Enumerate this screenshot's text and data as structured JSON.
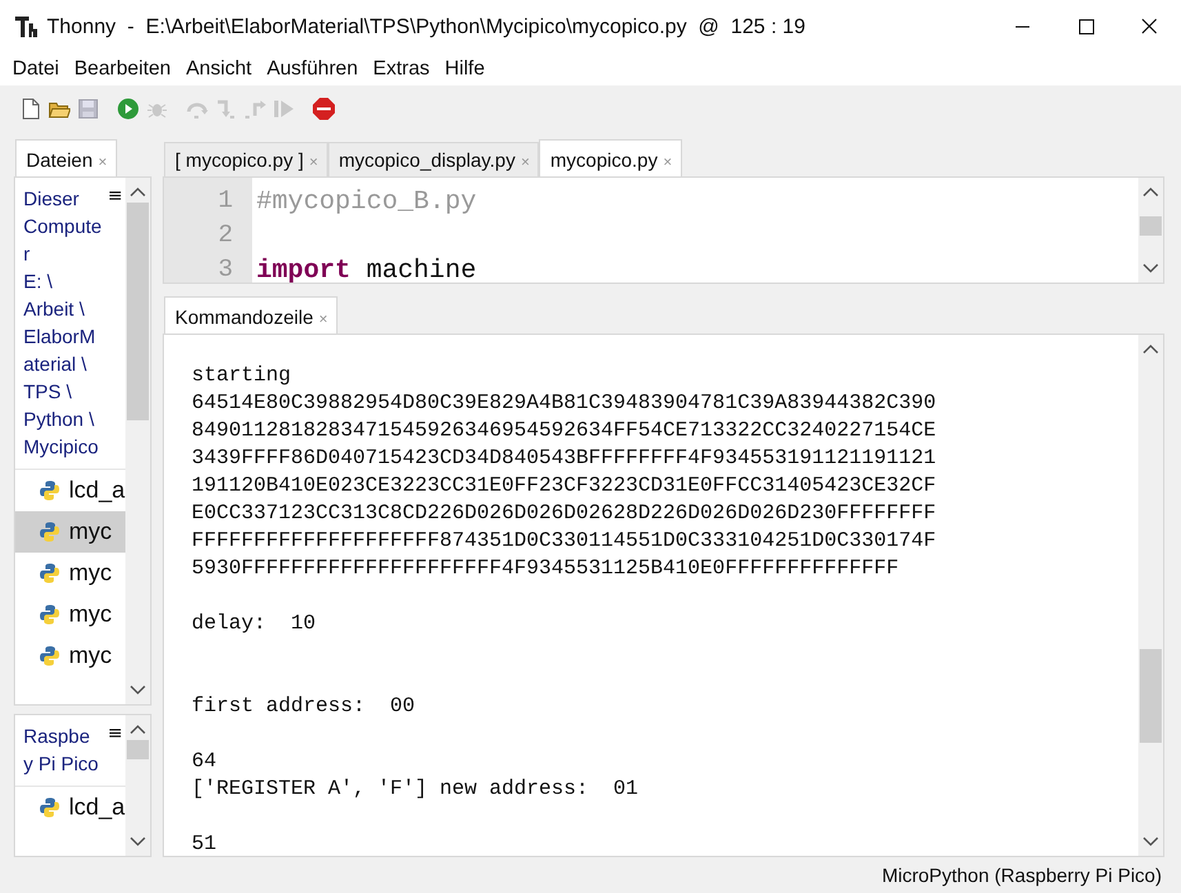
{
  "window": {
    "title": "Thonny  -  E:\\Arbeit\\ElaborMaterial\\TPS\\Python\\Mycipico\\mycopico.py  @  125 : 19"
  },
  "menu": [
    "Datei",
    "Bearbeiten",
    "Ansicht",
    "Ausführen",
    "Extras",
    "Hilfe"
  ],
  "toolbar": [
    {
      "kind": "new",
      "disabled": false
    },
    {
      "kind": "open",
      "disabled": false
    },
    {
      "kind": "save",
      "disabled": true
    },
    {
      "kind": "run",
      "disabled": false
    },
    {
      "kind": "debug",
      "disabled": true
    },
    {
      "kind": "step-over",
      "disabled": true
    },
    {
      "kind": "step-into",
      "disabled": true
    },
    {
      "kind": "step-out",
      "disabled": true
    },
    {
      "kind": "resume",
      "disabled": true
    },
    {
      "kind": "stop",
      "disabled": false
    }
  ],
  "files_panel": {
    "tab": {
      "label": "Dateien",
      "close": "×",
      "selected": true
    },
    "computer": {
      "heading": "Dieser Computer",
      "path": "E: \\ Arbeit \\ ElaborMaterial \\ TPS \\ Python \\ Mycipico",
      "menu": "≡",
      "files": [
        {
          "name": "lcd_a",
          "selected": false
        },
        {
          "name": "myc",
          "selected": true
        },
        {
          "name": "myc",
          "selected": false
        },
        {
          "name": "myc",
          "selected": false
        },
        {
          "name": "myc",
          "selected": false
        }
      ]
    },
    "device": {
      "heading": "Raspbe y Pi Pico",
      "menu": "≡",
      "files": [
        {
          "name": "lcd_a",
          "selected": false
        }
      ]
    }
  },
  "editor": {
    "tabs": [
      {
        "label": "[ mycopico.py ]",
        "close": "×",
        "selected": false
      },
      {
        "label": "mycopico_display.py",
        "close": "×",
        "selected": false
      },
      {
        "label": "mycopico.py",
        "close": "×",
        "selected": true
      }
    ],
    "lines": [
      {
        "number": "1",
        "kind": "comment",
        "text": "#mycopico_B.py"
      },
      {
        "number": "2",
        "kind": "blank"
      },
      {
        "number": "3",
        "kind": "import",
        "keyword": "import",
        "text": "machine"
      }
    ]
  },
  "shell": {
    "tab": {
      "label": "Kommandozeile",
      "close": "×",
      "selected": true
    },
    "output": [
      {
        "kind": "text",
        "text": "starting"
      },
      {
        "kind": "text",
        "text": "64514E80C39882954D80C39E829A4B81C39483904781C39A83944382C390"
      },
      {
        "kind": "text",
        "text": "8490112818283471545926346954592634FF54CE713322CC3240227154CE"
      },
      {
        "kind": "text",
        "text": "3439FFFF86D040715423CD34D840543BFFFFFFFF4F934553191121191121"
      },
      {
        "kind": "text",
        "text": "191120B410E023CE3223CC31E0FF23CF3223CD31E0FFCC31405423CE32CF"
      },
      {
        "kind": "text",
        "text": "E0CC337123CC313C8CD226D026D026D02628D226D026D026D230FFFFFFFF"
      },
      {
        "kind": "text",
        "text": "FFFFFFFFFFFFFFFFFFFF874351D0C330114551D0C333104251D0C330174F"
      },
      {
        "kind": "text",
        "text": "5930FFFFFFFFFFFFFFFFFFFFF4F9345531125B410E0FFFFFFFFFFFFFF"
      },
      {
        "kind": "blank"
      },
      {
        "kind": "text",
        "text": "delay:  10"
      },
      {
        "kind": "blank"
      },
      {
        "kind": "blank"
      },
      {
        "kind": "text",
        "text": "first address:  00"
      },
      {
        "kind": "blank"
      },
      {
        "kind": "text",
        "text": "64"
      },
      {
        "kind": "text",
        "text": "['REGISTER A', 'F'] new address:  01"
      },
      {
        "kind": "blank"
      },
      {
        "kind": "text",
        "text": "51"
      }
    ]
  },
  "status_bar": "MicroPython (Raspberry Pi Pico)"
}
